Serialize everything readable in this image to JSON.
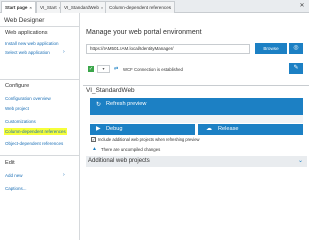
{
  "tabs": [
    {
      "label": "Start page",
      "active": true
    },
    {
      "label": "VI_Start",
      "active": false
    },
    {
      "label": "VI_StandardWeb",
      "active": false
    },
    {
      "label": "Column-dependent references",
      "active": false
    }
  ],
  "sidebar": {
    "title": "Web Designer",
    "sections": [
      {
        "heading": "Web applications",
        "items": [
          {
            "label": "Install new web application"
          },
          {
            "label": "Select web application",
            "chevron": true
          }
        ]
      },
      {
        "heading": "Configure",
        "items": [
          {
            "label": "Configuration overview"
          },
          {
            "label": "Web project"
          },
          {
            "label": "Customizations"
          },
          {
            "label": "Column-dependent references",
            "highlighted": true
          },
          {
            "label": "Object-dependent references"
          }
        ]
      },
      {
        "heading": "Edit",
        "items": [
          {
            "label": "Add new",
            "chevron": true
          },
          {
            "label": "Captions..."
          }
        ]
      }
    ]
  },
  "main": {
    "title": "Manage your web portal environment",
    "url_value": "https://IAM501.IAM.local/IdentityManager/",
    "browse_label": "Browse",
    "wcf_text": "WCF Connection is established",
    "project_title": "VI_StandardWeb",
    "refresh_label": "Refresh preview",
    "debug_label": "Debug",
    "release_label": "Release",
    "include_label": "Include additional web projects when refreshing preview",
    "warning_text": "There are uncompiled changes",
    "additional_label": "Additional web projects"
  },
  "colors": {
    "accent": "#1c80c4",
    "highlight": "#f6ff3a",
    "success": "#3aa64a"
  },
  "icons": [
    "close-icon",
    "chevron-right-icon",
    "globe-icon",
    "check-icon",
    "connection-icon",
    "refresh-icon",
    "debug-icon",
    "cloud-upload-icon",
    "warning-icon",
    "chevron-down-icon"
  ]
}
